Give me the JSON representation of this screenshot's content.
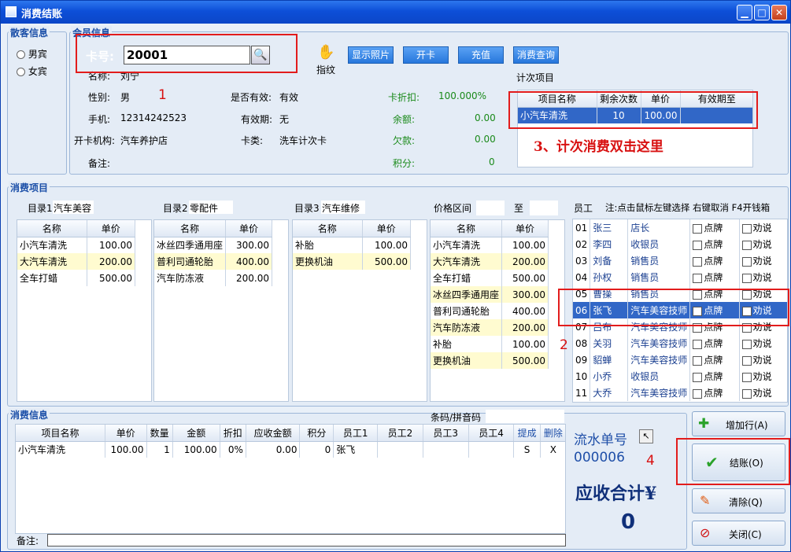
{
  "window": {
    "title": "消费结账"
  },
  "guest": {
    "title": "散客信息",
    "male": "男宾",
    "female": "女宾"
  },
  "member": {
    "title": "会员信息",
    "card_label": "卡号:",
    "card_value": "20001",
    "fingerprint": "指纹",
    "buttons": [
      "显示照片",
      "开卡",
      "充值",
      "消费查询"
    ],
    "name_label": "名称:",
    "name": "刘宁",
    "gender_label": "性别:",
    "gender": "男",
    "phone_label": "手机:",
    "phone": "12314242523",
    "org_label": "开卡机构:",
    "org": "汽车养护店",
    "note_label": "备注:",
    "valid_label": "是否有效:",
    "valid": "有效",
    "expiry_label": "有效期:",
    "expiry": "无",
    "cardtype_label": "卡类:",
    "cardtype": "洗车计次卡",
    "discount_label": "卡折扣:",
    "discount": "100.000%",
    "balance_label": "余额:",
    "balance": "0.00",
    "debt_label": "欠款:",
    "debt": "0.00",
    "points_label": "积分:",
    "points": "0"
  },
  "counted": {
    "title": "计次项目",
    "headers": [
      "项目名称",
      "剩余次数",
      "单价",
      "有效期至"
    ],
    "row": [
      "小汽车清洗",
      "10",
      "100.00",
      ""
    ]
  },
  "annotations": {
    "a1": "1",
    "a2": "2",
    "a3": "3、计次消费双击这里",
    "a4": "4"
  },
  "consume": {
    "title": "消费项目",
    "cat1_label": "目录1",
    "cat1": "汽车美容",
    "cat2_label": "目录2",
    "cat2": "零配件",
    "cat3_label": "目录3",
    "cat3": "汽车维修",
    "price_range_label": "价格区间",
    "price_to": "至",
    "col_name": "名称",
    "col_price": "单价",
    "list1": [
      [
        "小汽车清洗",
        "100.00"
      ],
      [
        "大汽车清洗",
        "200.00"
      ],
      [
        "全车打蜡",
        "500.00"
      ]
    ],
    "list2": [
      [
        "冰丝四季通用座",
        "300.00"
      ],
      [
        "普利司通轮胎",
        "400.00"
      ],
      [
        "汽车防冻液",
        "200.00"
      ]
    ],
    "list3": [
      [
        "补胎",
        "100.00"
      ],
      [
        "更换机油",
        "500.00"
      ]
    ],
    "list4": [
      [
        "小汽车清洗",
        "100.00"
      ],
      [
        "大汽车清洗",
        "200.00"
      ],
      [
        "全车打蜡",
        "500.00"
      ],
      [
        "冰丝四季通用座",
        "300.00"
      ],
      [
        "普利司通轮胎",
        "400.00"
      ],
      [
        "汽车防冻液",
        "200.00"
      ],
      [
        "补胎",
        "100.00"
      ],
      [
        "更换机油",
        "500.00"
      ]
    ],
    "staff_label": "员工",
    "staff_note": "注:点击鼠标左键选择 右键取消 F4开钱箱",
    "pick": "点牌",
    "persuade": "劝说",
    "staff": [
      [
        "01",
        "张三",
        "店长"
      ],
      [
        "02",
        "李四",
        "收银员"
      ],
      [
        "03",
        "刘备",
        "销售员"
      ],
      [
        "04",
        "孙权",
        "销售员"
      ],
      [
        "05",
        "曹操",
        "销售员"
      ],
      [
        "06",
        "张飞",
        "汽车美容技师"
      ],
      [
        "07",
        "吕布",
        "汽车美容技师"
      ],
      [
        "08",
        "关羽",
        "汽车美容技师"
      ],
      [
        "09",
        "貂蝉",
        "汽车美容技师"
      ],
      [
        "10",
        "小乔",
        "收银员"
      ],
      [
        "11",
        "大乔",
        "汽车美容技师"
      ]
    ]
  },
  "bill": {
    "title": "消费信息",
    "barcode_label": "条码/拼音码",
    "headers": [
      "项目名称",
      "单价",
      "数量",
      "金额",
      "折扣",
      "应收金额",
      "积分",
      "员工1",
      "员工2",
      "员工3",
      "员工4",
      "提成",
      "删除"
    ],
    "row": [
      "小汽车清洗",
      "100.00",
      "1",
      "100.00",
      "0%",
      "0.00",
      "0",
      "张飞",
      "",
      "",
      "",
      "S",
      "X"
    ],
    "note_label": "备注:",
    "serial_label": "流水单号",
    "serial": "000006",
    "total_label": "应收合计¥",
    "total": "0"
  },
  "actions": {
    "add": "增加行(A)",
    "checkout": "结账(O)",
    "clear": "清除(Q)",
    "close": "关闭(C)"
  }
}
